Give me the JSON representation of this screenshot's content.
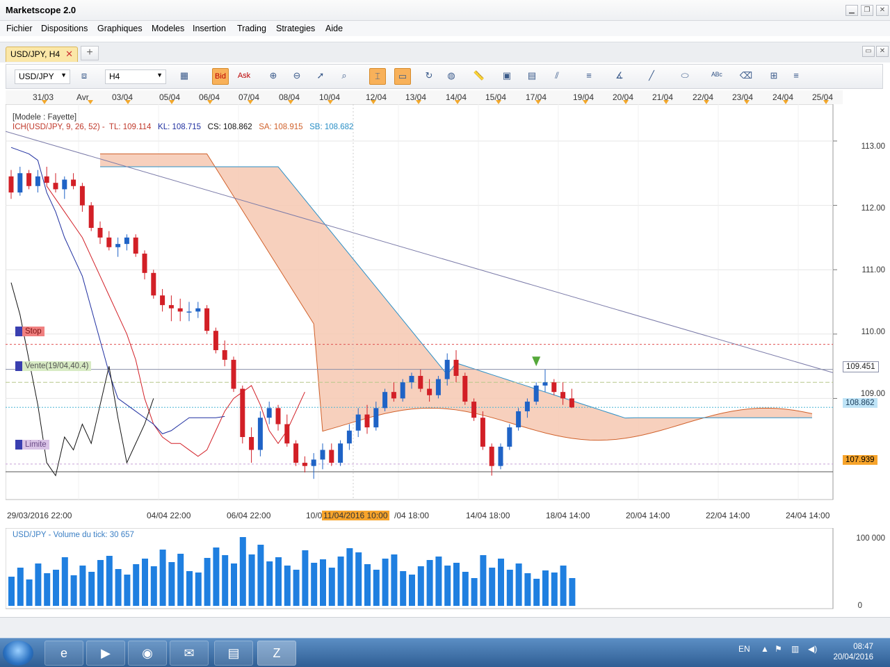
{
  "window": {
    "title": "Marketscope 2.0"
  },
  "menu": [
    "Fichier",
    "Dispositions",
    "Graphiques",
    "Modeles",
    "Insertion",
    "Trading",
    "Strategies",
    "Aide"
  ],
  "tab": {
    "label": "USD/JPY, H4",
    "close": "✕",
    "add": "+"
  },
  "toolbar": {
    "symbol": "USD/JPY",
    "timeframe": "H4",
    "bid": "Bid",
    "ask": "Ask"
  },
  "datebar": [
    "31/03",
    "Avr",
    "03/04",
    "05/04",
    "06/04",
    "07/04",
    "08/04",
    "10/04",
    "12/04",
    "13/04",
    "14/04",
    "15/04",
    "17/04",
    "19/04",
    "20/04",
    "21/04",
    "22/04",
    "23/04",
    "24/04",
    "25/04"
  ],
  "chart": {
    "legend_model": "[Modele : Fayette]",
    "ichimoku": {
      "name": "ICH(USD/JPY, 9, 26, 52) -",
      "tl": "TL: 109.114",
      "kl": "KL: 108.715",
      "cs": "CS: 108.862",
      "sa": "SA: 108.915",
      "sb": "SB: 108.682"
    },
    "price_axis": [
      "113.00",
      "112.00",
      "111.00",
      "110.00",
      "109.00"
    ],
    "price_tags": {
      "upper": "109.451",
      "current": "108.862",
      "lower": "107.939"
    },
    "order_tags": {
      "stop": "Stop",
      "sell": "Vente(19/04,40.4)",
      "limit": "Limite"
    },
    "time_axis": [
      "29/03/2016 22:00",
      "04/04 22:00",
      "06/04 22:00",
      "10/0",
      "/04 18:00",
      "14/04 18:00",
      "18/04 14:00",
      "20/04 14:00",
      "22/04 14:00",
      "24/04 14:00"
    ],
    "time_highlight": "11/04/2016 10:00"
  },
  "volume": {
    "legend": "USD/JPY - Volume du tick: 30 657",
    "axis": [
      "100 000",
      "0"
    ]
  },
  "taskbar": {
    "lang": "EN",
    "time": "08:47",
    "date": "20/04/2016"
  },
  "chart_data": {
    "type": "candlestick",
    "ylim": [
      107.45,
      113.55
    ],
    "candles": [
      [
        112.45,
        112.55,
        112.1,
        112.2
      ],
      [
        112.2,
        112.6,
        112.15,
        112.5
      ],
      [
        112.5,
        112.55,
        112.25,
        112.3
      ],
      [
        112.3,
        112.55,
        112.2,
        112.45
      ],
      [
        112.45,
        112.6,
        112.3,
        112.35
      ],
      [
        112.35,
        112.5,
        112.2,
        112.25
      ],
      [
        112.25,
        112.45,
        112.1,
        112.4
      ],
      [
        112.4,
        112.5,
        112.25,
        112.3
      ],
      [
        112.3,
        112.35,
        111.9,
        112.0
      ],
      [
        112.0,
        112.05,
        111.6,
        111.65
      ],
      [
        111.65,
        111.75,
        111.4,
        111.5
      ],
      [
        111.5,
        111.6,
        111.3,
        111.35
      ],
      [
        111.35,
        111.5,
        111.2,
        111.4
      ],
      [
        111.4,
        111.55,
        111.3,
        111.5
      ],
      [
        111.5,
        111.55,
        111.2,
        111.25
      ],
      [
        111.25,
        111.3,
        110.85,
        110.95
      ],
      [
        110.95,
        111.0,
        110.55,
        110.6
      ],
      [
        110.6,
        110.7,
        110.35,
        110.45
      ],
      [
        110.45,
        110.6,
        110.2,
        110.4
      ],
      [
        110.4,
        110.55,
        110.2,
        110.35
      ],
      [
        110.35,
        110.5,
        110.2,
        110.35
      ],
      [
        110.35,
        110.5,
        110.25,
        110.4
      ],
      [
        110.4,
        110.45,
        110.0,
        110.05
      ],
      [
        110.05,
        110.1,
        109.7,
        109.75
      ],
      [
        109.75,
        109.9,
        109.5,
        109.6
      ],
      [
        109.6,
        109.65,
        109.1,
        109.15
      ],
      [
        109.15,
        109.2,
        108.3,
        108.4
      ],
      [
        108.4,
        108.55,
        108.0,
        108.2
      ],
      [
        108.2,
        108.8,
        108.1,
        108.7
      ],
      [
        108.7,
        108.95,
        108.6,
        108.85
      ],
      [
        108.85,
        108.9,
        108.5,
        108.6
      ],
      [
        108.6,
        108.75,
        108.25,
        108.3
      ],
      [
        108.3,
        108.35,
        107.95,
        108.0
      ],
      [
        108.0,
        108.1,
        107.85,
        107.95
      ],
      [
        107.95,
        108.15,
        107.75,
        108.05
      ],
      [
        108.05,
        108.3,
        107.9,
        108.2
      ],
      [
        108.2,
        108.3,
        107.95,
        108.0
      ],
      [
        108.0,
        108.35,
        107.95,
        108.3
      ],
      [
        108.3,
        108.6,
        108.2,
        108.5
      ],
      [
        108.5,
        108.85,
        108.4,
        108.75
      ],
      [
        108.75,
        108.9,
        108.45,
        108.55
      ],
      [
        108.55,
        108.95,
        108.5,
        108.85
      ],
      [
        108.85,
        109.15,
        108.8,
        109.1
      ],
      [
        109.1,
        109.25,
        108.95,
        109.0
      ],
      [
        109.0,
        109.3,
        108.95,
        109.25
      ],
      [
        109.25,
        109.4,
        109.15,
        109.35
      ],
      [
        109.35,
        109.45,
        109.1,
        109.15
      ],
      [
        109.15,
        109.3,
        108.95,
        109.05
      ],
      [
        109.05,
        109.35,
        109.0,
        109.3
      ],
      [
        109.3,
        109.7,
        109.2,
        109.6
      ],
      [
        109.6,
        109.75,
        109.25,
        109.35
      ],
      [
        109.35,
        109.4,
        108.9,
        108.95
      ],
      [
        108.95,
        109.0,
        108.65,
        108.7
      ],
      [
        108.7,
        108.8,
        108.2,
        108.25
      ],
      [
        108.25,
        108.3,
        107.8,
        107.95
      ],
      [
        107.95,
        108.3,
        107.9,
        108.25
      ],
      [
        108.25,
        108.6,
        108.2,
        108.55
      ],
      [
        108.55,
        108.85,
        108.5,
        108.8
      ],
      [
        108.8,
        109.0,
        108.7,
        108.95
      ],
      [
        108.95,
        109.25,
        108.9,
        109.2
      ],
      [
        109.2,
        109.45,
        109.1,
        109.25
      ],
      [
        109.25,
        109.3,
        109.05,
        109.1
      ],
      [
        109.1,
        109.25,
        108.9,
        109.0
      ],
      [
        109.0,
        109.15,
        108.85,
        108.86
      ]
    ],
    "volume": [
      42,
      55,
      38,
      61,
      47,
      52,
      70,
      44,
      58,
      49,
      66,
      72,
      53,
      45,
      60,
      68,
      57,
      81,
      63,
      75,
      50,
      48,
      69,
      84,
      73,
      61,
      99,
      74,
      88,
      64,
      70,
      58,
      52,
      80,
      62,
      67,
      55,
      71,
      83,
      77,
      60,
      52,
      68,
      74,
      50,
      45,
      57,
      66,
      71,
      58,
      62,
      49,
      40,
      73,
      55,
      68,
      52,
      61,
      47,
      39,
      51,
      48,
      58,
      40
    ],
    "tenkan": [
      112.3,
      112.1,
      111.9,
      111.7,
      111.5,
      111.2,
      110.9,
      110.6,
      110.3,
      110.0,
      109.6,
      109.0,
      108.6,
      108.4,
      108.3,
      108.3,
      108.2,
      108.1,
      108.2,
      108.5,
      108.8,
      109.0,
      109.1,
      109.2,
      108.9,
      108.5,
      108.3,
      108.5,
      108.8,
      109.1
    ],
    "kijun": [
      112.9,
      112.85,
      112.8,
      112.7,
      112.2,
      111.9,
      111.5,
      111.2,
      110.9,
      110.4,
      109.9,
      109.4,
      109.0,
      108.9,
      108.8,
      108.7,
      108.6,
      108.45,
      108.5,
      108.6,
      108.7,
      108.7,
      108.7,
      108.7,
      108.72
    ],
    "chikou": [
      110.8,
      110.3,
      109.6,
      108.9,
      108.0,
      107.8,
      108.4,
      108.2,
      108.6,
      108.3,
      108.9,
      109.5,
      108.7,
      108.0,
      108.3,
      108.6,
      109.0
    ]
  }
}
